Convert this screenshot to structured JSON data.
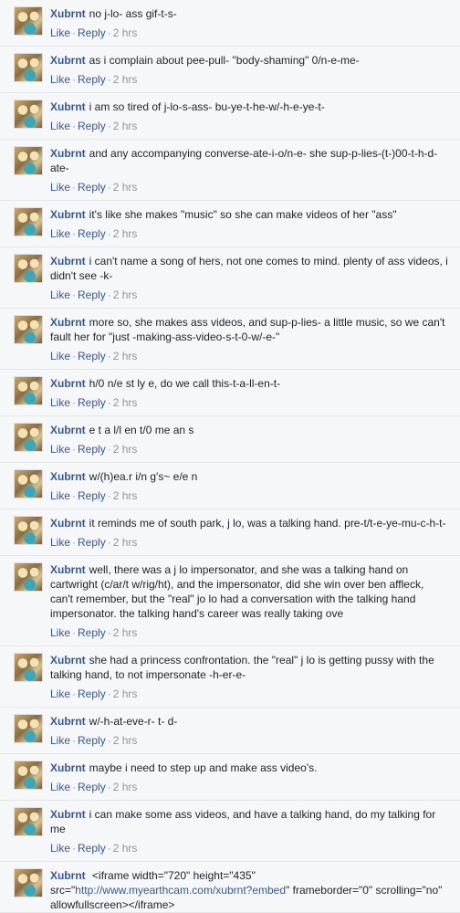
{
  "labels": {
    "like": "Like",
    "reply": "Reply",
    "separator": "·"
  },
  "comments": [
    {
      "author": "Xubrnt",
      "text": "no j-lo- ass gif-t-s-",
      "time": "2 hrs"
    },
    {
      "author": "Xubrnt",
      "text": "as i complain about pee-pull- \"body-shaming\" 0/n-e-me-",
      "time": "2 hrs"
    },
    {
      "author": "Xubrnt",
      "text": "i am so tired of j-lo-s-ass- bu-ye-t-he-w/-h-e-ye-t-",
      "time": "2 hrs"
    },
    {
      "author": "Xubrnt",
      "text": "and any accompanying converse-ate-i-o/n-e- she sup-p-lies-(t-)00-t-h-d-ate-",
      "time": "2 hrs"
    },
    {
      "author": "Xubrnt",
      "text": "it's like she makes \"music\" so she can make videos of her \"ass\"",
      "time": "2 hrs"
    },
    {
      "author": "Xubrnt",
      "text": "i can't name a song of hers, not one comes to mind. plenty of ass videos, i didn't see -k-",
      "time": "2 hrs"
    },
    {
      "author": "Xubrnt",
      "text": "more so, she makes ass videos, and sup-p-lies- a little music, so we can't fault her for \"just -making-ass-video-s-t-0-w/-e-\"",
      "time": "2 hrs"
    },
    {
      "author": "Xubrnt",
      "text": "h/0 n/e st ly e, do we call this-t-a-ll-en-t-",
      "time": "2 hrs"
    },
    {
      "author": "Xubrnt",
      "text": "e t a l/l en t/0 me an s",
      "time": "2 hrs"
    },
    {
      "author": "Xubrnt",
      "text": "w/(h)ea.r i/n g's~ e/e n",
      "time": "2 hrs"
    },
    {
      "author": "Xubrnt",
      "text": "it reminds me of south park, j lo, was a talking hand. pre-t/t-e-ye-mu-c-h-t-",
      "time": "2 hrs"
    },
    {
      "author": "Xubrnt",
      "text": "well, there was a j lo impersonator, and she was a talking hand on cartwright (c/ar/t w/rig/ht), and the impersonator, did she win over ben affleck, can't remember, but the \"real\" jo lo had a conversation with the talking hand impersonator. the talking hand's career was really taking ove",
      "time": "2 hrs"
    },
    {
      "author": "Xubrnt",
      "text": "she had a princess confrontation. the \"real\" j lo is getting pussy with the talking hand, to not impersonate -h-er-e-",
      "time": "2 hrs"
    },
    {
      "author": "Xubrnt",
      "text": "w/-h-at-eve-r- t- d-",
      "time": "2 hrs"
    },
    {
      "author": "Xubrnt",
      "text": "maybe i need to step up and make ass video's.",
      "time": "2 hrs"
    },
    {
      "author": "Xubrnt",
      "text": "i can make some ass videos, and have a talking hand, do my talking for me",
      "time": "2 hrs"
    }
  ],
  "last_comment": {
    "author": "Xubrnt",
    "text_before": "<iframe width=\"720\" height=\"435\" src=\"",
    "link": "http://www.myearthcam.com/xubrnt?embed",
    "text_after": "\" frameborder=\"0\" scrolling=\"no\" allowfullscreen></iframe>"
  }
}
